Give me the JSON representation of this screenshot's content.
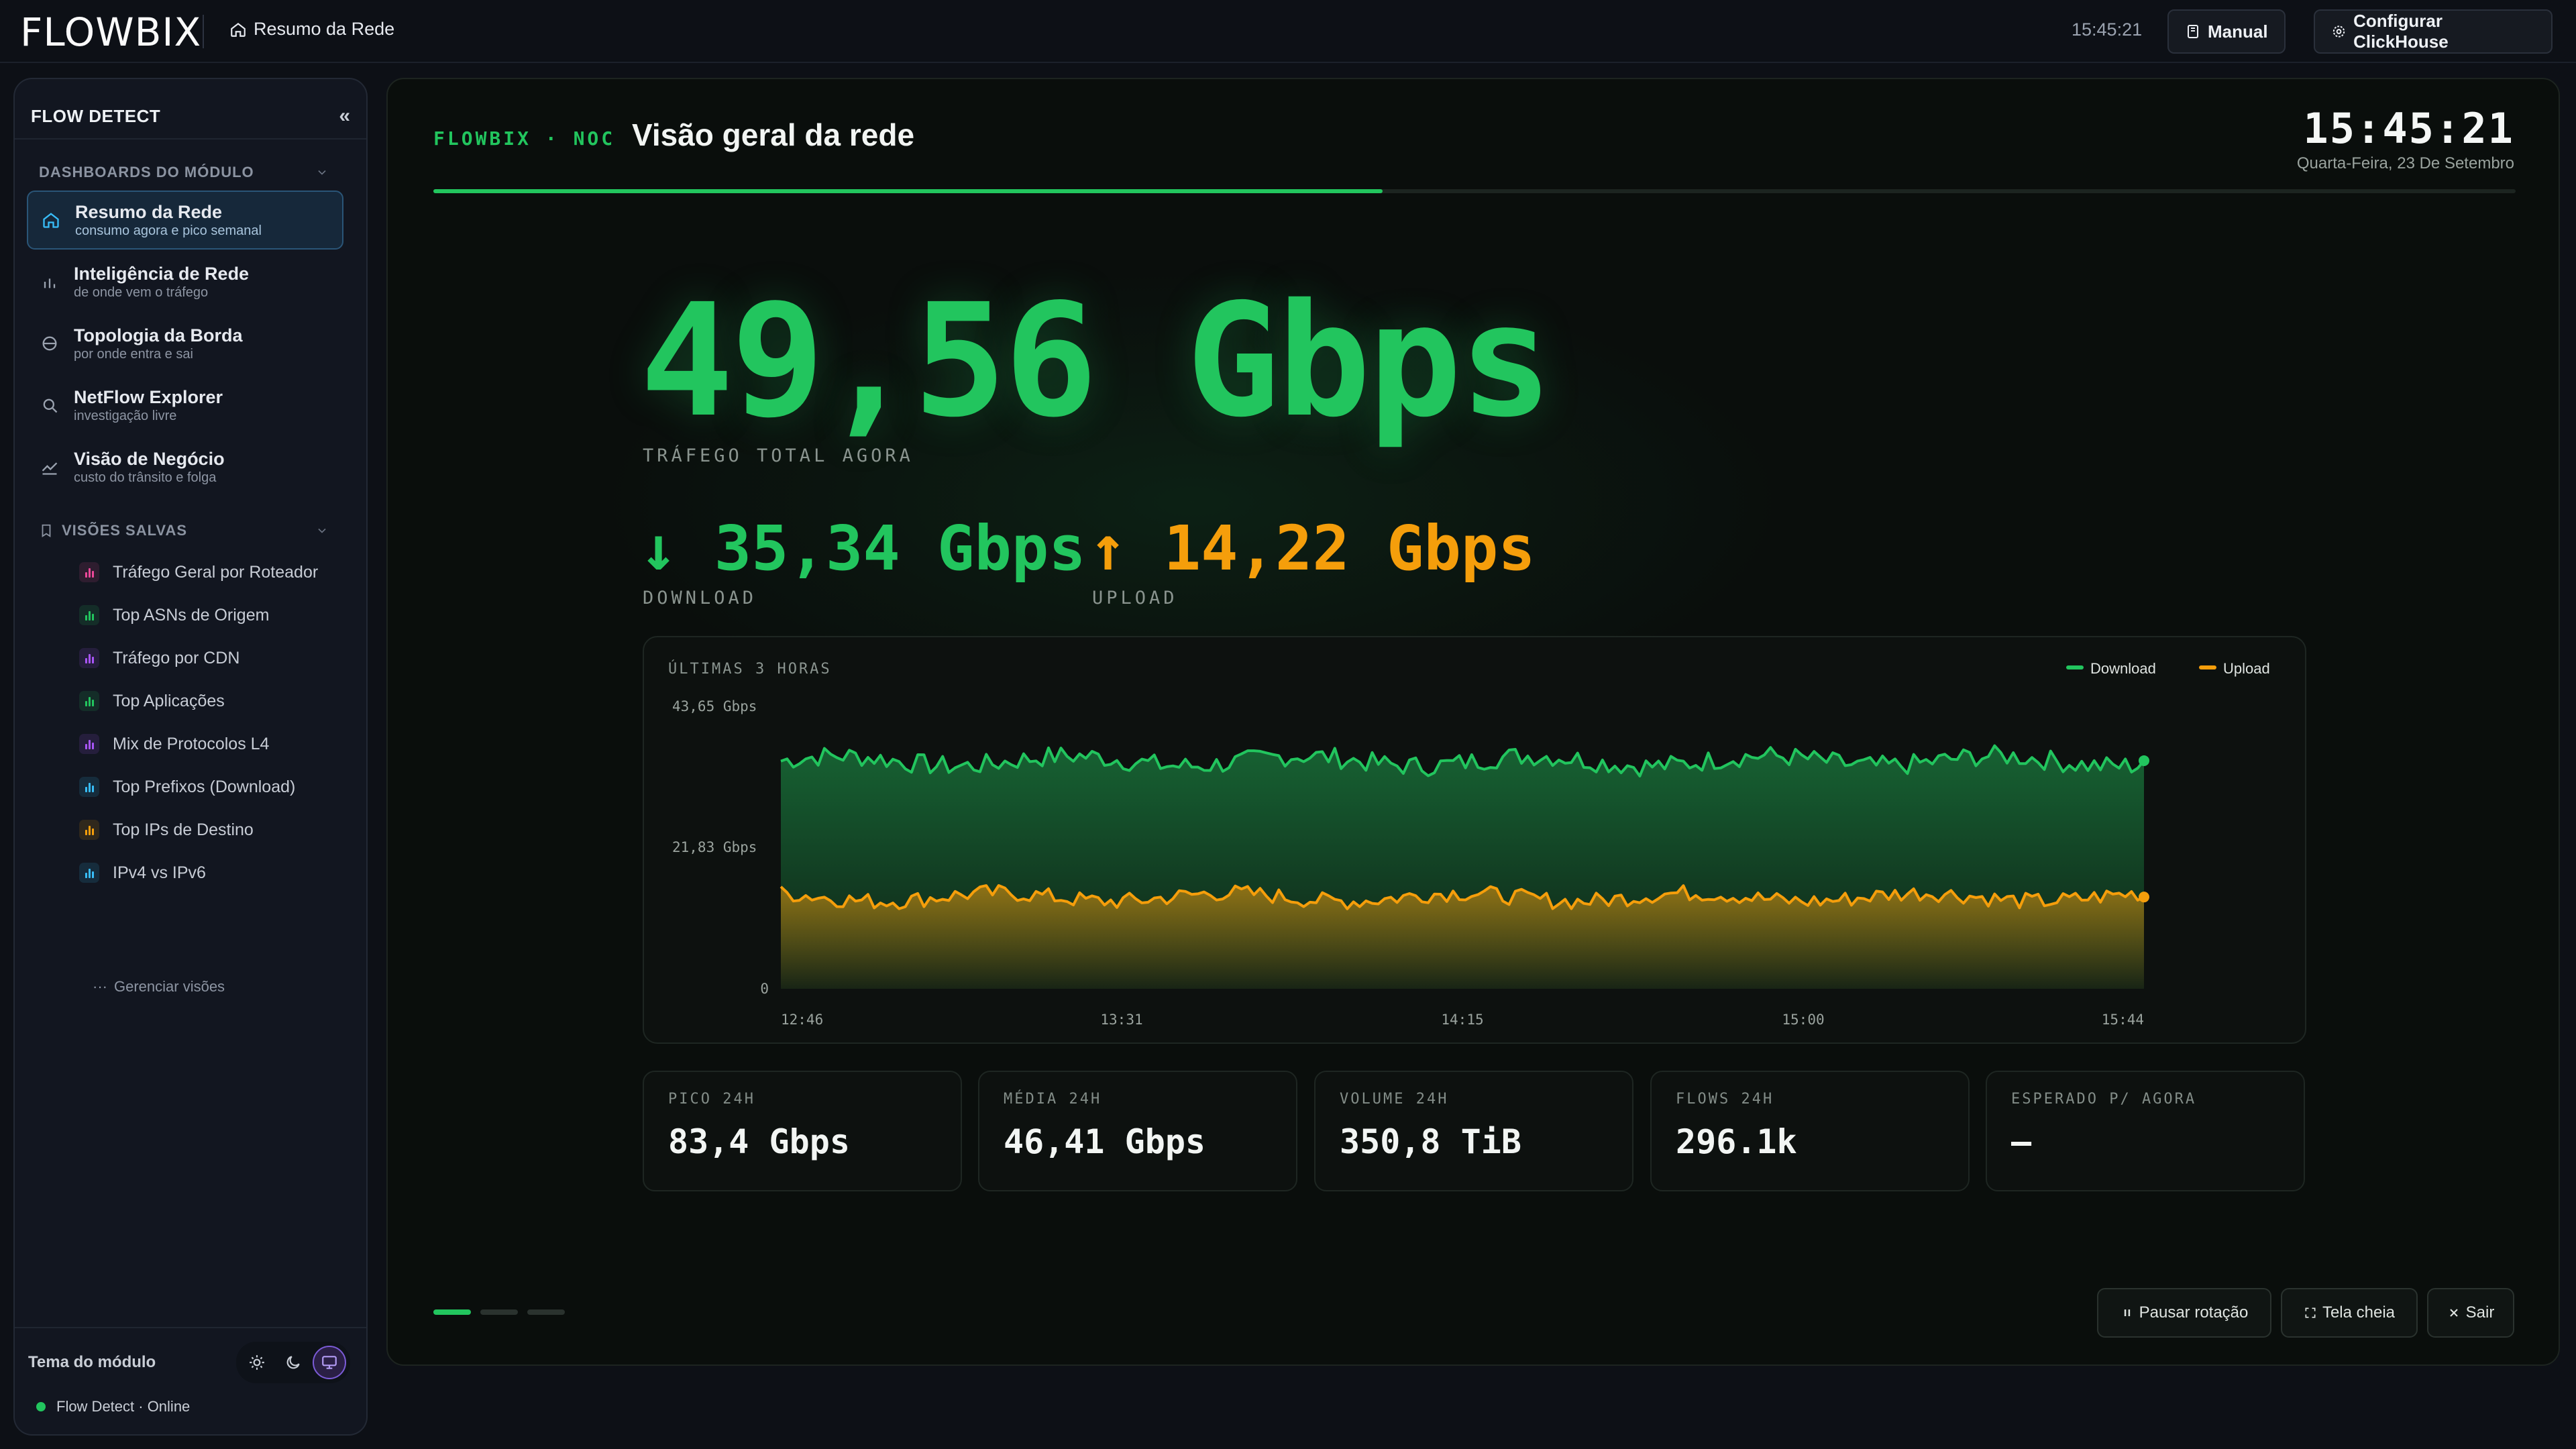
{
  "app": {
    "logo": "FLOWBIX",
    "breadcrumb": "Resumo da Rede",
    "time": "15:45:21"
  },
  "top_buttons": {
    "manual": "Manual",
    "config": "Configurar ClickHouse"
  },
  "sidebar": {
    "title": "FLOW DETECT",
    "collapse": "«",
    "dashboards_label": "DASHBOARDS DO MÓDULO",
    "items": [
      {
        "label": "Resumo da Rede",
        "sub": "consumo agora e pico semanal",
        "icon": "home-icon"
      },
      {
        "label": "Inteligência de Rede",
        "sub": "de onde vem o tráfego",
        "icon": "bar-chart-icon"
      },
      {
        "label": "Topologia da Borda",
        "sub": "por onde entra e sai",
        "icon": "globe-icon"
      },
      {
        "label": "NetFlow Explorer",
        "sub": "investigação livre",
        "icon": "search-icon"
      },
      {
        "label": "Visão de Negócio",
        "sub": "custo do trânsito e folga",
        "icon": "trend-icon"
      }
    ],
    "saved_label": "VISÕES SALVAS",
    "saved": [
      {
        "label": "Tráfego Geral por Roteador",
        "color": "#ec4899"
      },
      {
        "label": "Top ASNs de Origem",
        "color": "#22c55e"
      },
      {
        "label": "Tráfego por CDN",
        "color": "#a855f7"
      },
      {
        "label": "Top Aplicações",
        "color": "#22c55e"
      },
      {
        "label": "Mix de Protocolos L4",
        "color": "#a855f7"
      },
      {
        "label": "Top Prefixos (Download)",
        "color": "#38bdf8"
      },
      {
        "label": "Top IPs de Destino",
        "color": "#f59e0b"
      },
      {
        "label": "IPv4 vs IPv6",
        "color": "#38bdf8"
      }
    ],
    "manage": "Gerenciar visões",
    "manage_prefix": "···",
    "theme_label": "Tema do módulo",
    "status": "Flow Detect · Online"
  },
  "main": {
    "brand": "FLOWBIX · NOC",
    "title": "Visão geral da rede",
    "clock": "15:45:21",
    "date": "Quarta-Feira, 23 De Setembro",
    "rotation_progress": 0.456,
    "total_value": "49,56 Gbps",
    "total_label": "TRÁFEGO TOTAL AGORA",
    "download_value": "↓ 35,34 Gbps",
    "download_label": "DOWNLOAD",
    "upload_value": "↑ 14,22 Gbps",
    "upload_label": "UPLOAD",
    "stats": [
      {
        "label": "PICO 24H",
        "value": "83,4 Gbps"
      },
      {
        "label": "MÉDIA 24H",
        "value": "46,41 Gbps"
      },
      {
        "label": "VOLUME 24H",
        "value": "350,8 TiB"
      },
      {
        "label": "FLOWS 24H",
        "value": "296.1k"
      },
      {
        "label": "ESPERADO P/ AGORA",
        "value": "—"
      }
    ],
    "controls": {
      "pause": "Pausar rotação",
      "fullscreen": "Tela cheia",
      "exit": "Sair"
    },
    "colors": {
      "download": "#22c55e",
      "upload": "#f59e0b"
    }
  },
  "chart_data": {
    "type": "area",
    "title": "ÚLTIMAS 3 HORAS",
    "x_labels": [
      "12:46",
      "13:31",
      "14:15",
      "15:00",
      "15:44"
    ],
    "y_labels": [
      "43,65 Gbps",
      "21,83 Gbps",
      "0"
    ],
    "ylim": [
      0,
      43.65
    ],
    "legend_position": "top-right",
    "series": [
      {
        "name": "Download",
        "color": "#22c55e",
        "mean": 35.3,
        "last": 35.34
      },
      {
        "name": "Upload",
        "color": "#f59e0b",
        "mean": 14.2,
        "last": 14.22
      }
    ]
  }
}
